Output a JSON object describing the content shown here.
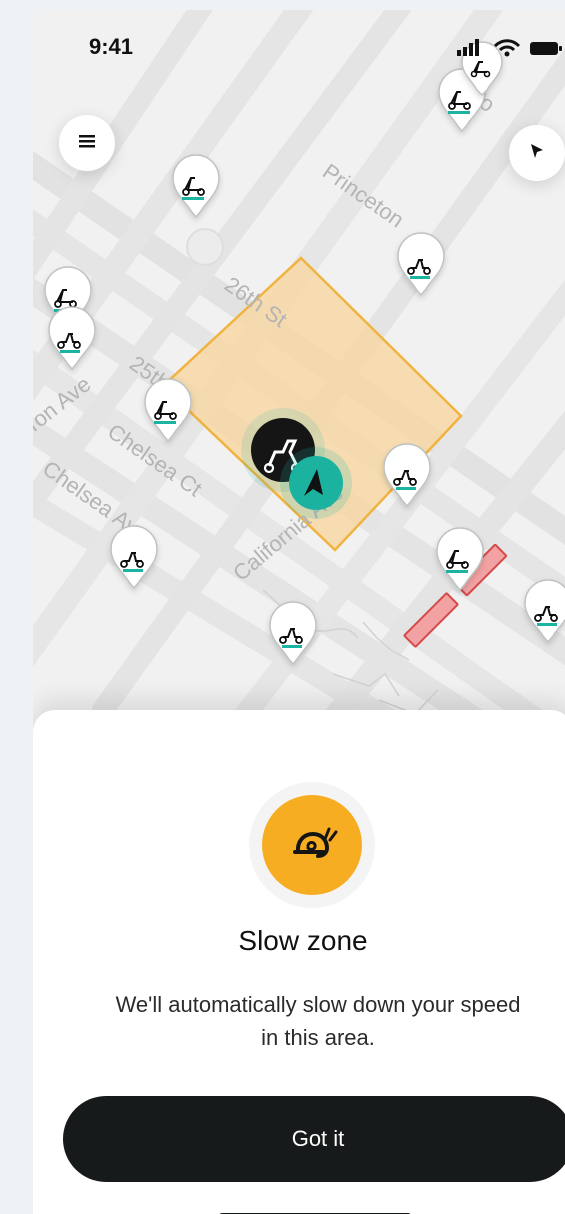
{
  "status_bar": {
    "time": "9:41"
  },
  "map": {
    "street_labels": [
      "Princeton",
      "26th St",
      "25th St",
      "Chelsea Ct",
      "Chelsea Ave",
      "Ton Ave",
      "California Ave",
      "Oro"
    ],
    "zone_fill": "#f6d7a1",
    "zone_stroke": "#f0b33f",
    "accent": "#1bb3a0",
    "restricted_color": "#f2a2a2"
  },
  "icons": {
    "menu": "menu-icon",
    "locate": "navigation-arrow-icon",
    "signal": "signal-icon",
    "wifi": "wifi-icon",
    "battery": "battery-icon",
    "slow_zone": "snail-icon"
  },
  "sheet": {
    "title": "Slow zone",
    "description": "We'll automatically slow down your speed in this area.",
    "primary_button": "Got it"
  }
}
